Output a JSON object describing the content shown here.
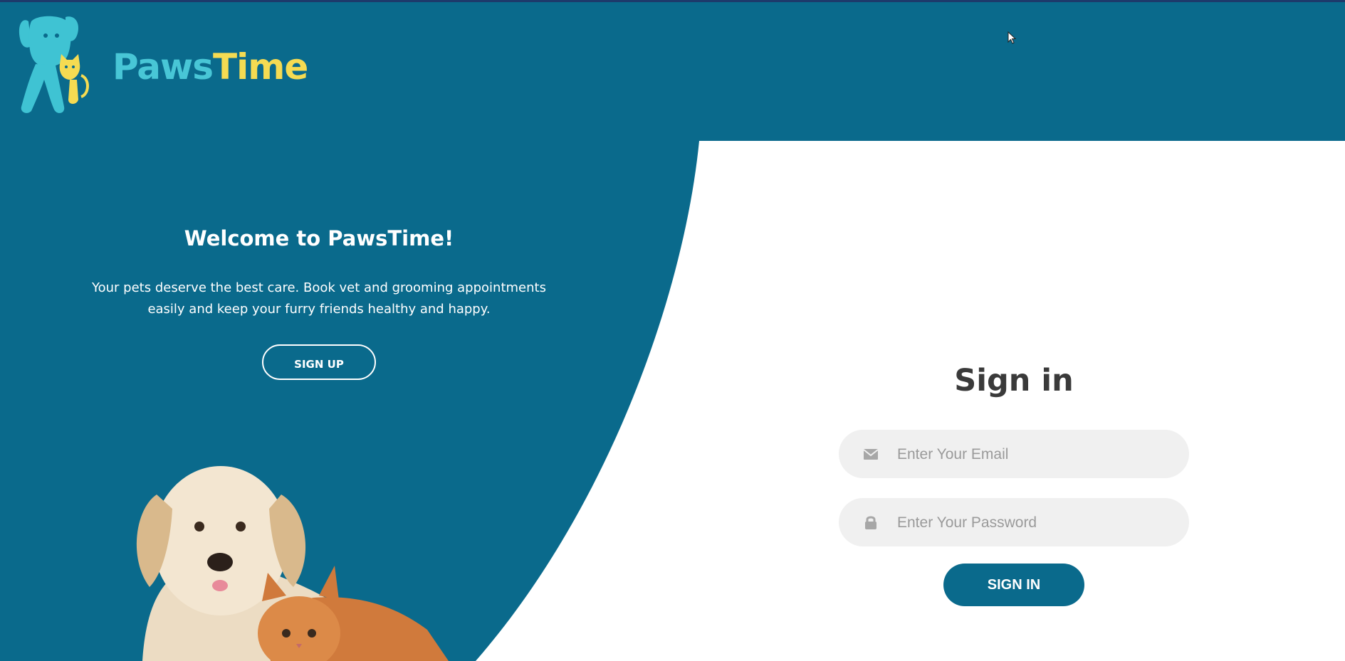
{
  "brand": {
    "name_part1": "Paws",
    "name_part2": "Time"
  },
  "colors": {
    "primary": "#0a6a8c",
    "brand_teal": "#48c6d6",
    "brand_yellow": "#f5db52",
    "input_bg": "#f0f0f0"
  },
  "welcome": {
    "title": "Welcome to PawsTime!",
    "text": "Your pets deserve the best care. Book vet and grooming appointments easily and keep your furry friends healthy and happy.",
    "signup_label": "SIGN UP"
  },
  "signin": {
    "title": "Sign in",
    "email": {
      "placeholder": "Enter Your Email",
      "value": "",
      "icon": "envelope-icon"
    },
    "password": {
      "placeholder": "Enter Your Password",
      "value": "",
      "icon": "lock-icon"
    },
    "submit_label": "SIGN IN"
  }
}
